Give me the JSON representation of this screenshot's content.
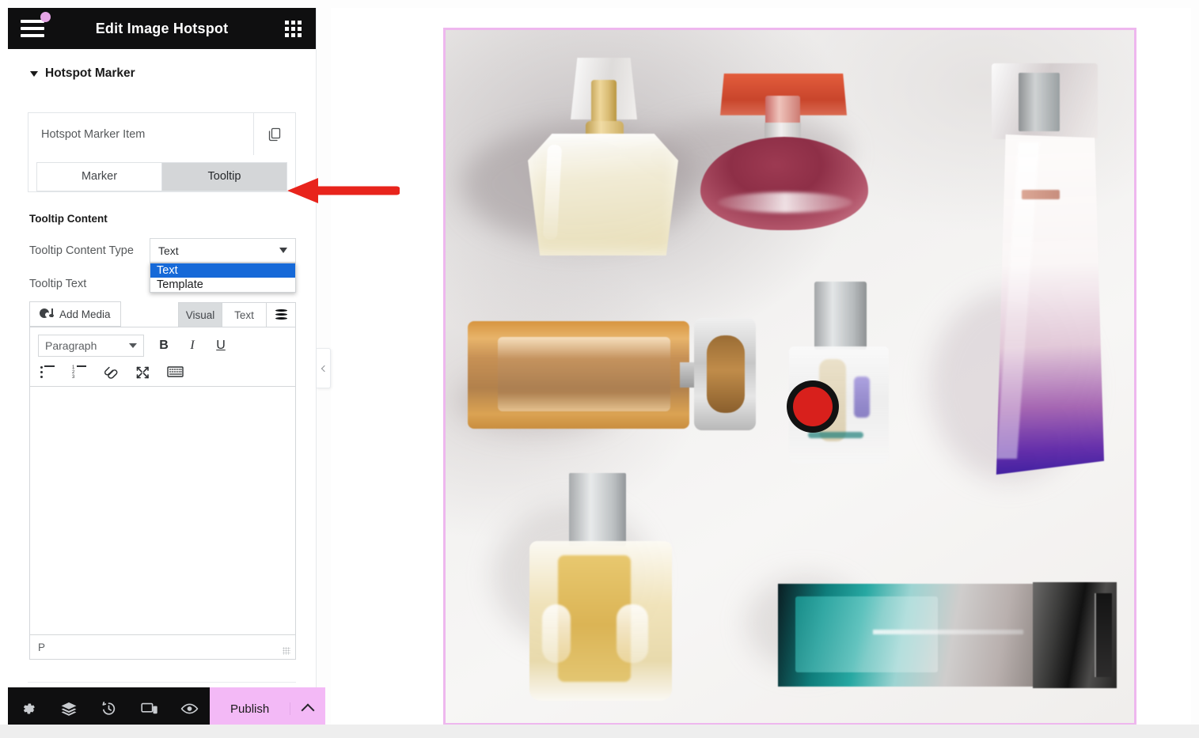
{
  "panel": {
    "header": {
      "title": "Edit Image Hotspot",
      "menu_icon": "hamburger-menu-icon",
      "apps_icon": "apps-grid-icon"
    },
    "section": {
      "title": "Hotspot Marker",
      "collapse_icon": "caret-down-icon"
    },
    "repeater": {
      "item_title": "Hotspot Marker Item",
      "duplicate_icon": "duplicate-icon"
    },
    "tabs": [
      {
        "label": "Marker",
        "active": false
      },
      {
        "label": "Tooltip",
        "active": true
      }
    ],
    "tooltip_content": {
      "group_title": "Tooltip Content",
      "content_type_label": "Tooltip Content Type",
      "content_type_value": "Text",
      "content_type_options": [
        {
          "label": "Text",
          "selected": true
        },
        {
          "label": "Template",
          "selected": false
        }
      ],
      "tooltip_text_label": "Tooltip Text"
    },
    "editor": {
      "add_media_label": "Add Media",
      "add_media_icon": "media-icon",
      "tabs": [
        {
          "label": "Visual",
          "active": true
        },
        {
          "label": "Text",
          "active": false
        }
      ],
      "dynamic_icon": "dynamic-tags-icon",
      "format_select_value": "Paragraph",
      "bold_label": "B",
      "italic_label": "I",
      "underline_label": "U",
      "toolbar_icons": [
        "bulleted-list-icon",
        "numbered-list-icon",
        "insert-link-icon",
        "fullscreen-icon",
        "toolbar-toggle-icon"
      ],
      "body_text": "",
      "status_path": "P",
      "resize_handle_icon": "resize-grip-icon"
    },
    "footer": {
      "icons": [
        "settings-gear-icon",
        "navigator-layers-icon",
        "history-clock-icon",
        "responsive-mode-icon",
        "preview-eye-icon"
      ],
      "publish_label": "Publish",
      "publish_arrow_icon": "chevron-up-icon",
      "publish_color": "#f3b9f6"
    },
    "collapse_handle_icon": "chevron-left-icon"
  },
  "annotation": {
    "arrow_icon": "left-arrow-annotation",
    "color": "#e8241c"
  },
  "canvas": {
    "border_color": "#eeb7ee",
    "image_alt": "perfume-bottles-flat-lay",
    "hotspot_marker": {
      "icon": "hotspot-marker-dot",
      "fill_color": "#d8201c",
      "ring_color": "#121212"
    }
  }
}
